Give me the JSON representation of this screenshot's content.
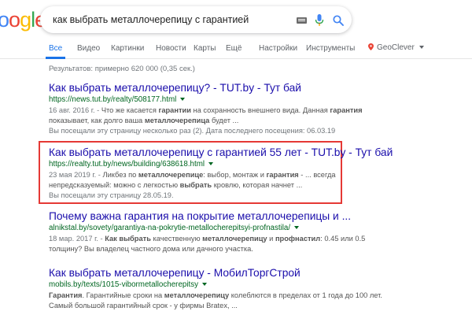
{
  "logo": {
    "text": "ogle"
  },
  "search": {
    "query": "как выбрать металлочерепицу с гарантией"
  },
  "tabs": [
    {
      "label": "Все",
      "active": true
    },
    {
      "label": "Видео"
    },
    {
      "label": "Картинки"
    },
    {
      "label": "Новости"
    },
    {
      "label": "Карты"
    },
    {
      "label": "Ещё"
    },
    {
      "label": "Настройки"
    },
    {
      "label": "Инструменты"
    }
  ],
  "location": {
    "label": "GeoClever"
  },
  "stats": {
    "text": "Результатов: примерно 620 000 (0,35 сек.)"
  },
  "results": [
    {
      "title": "Как выбрать металлочерепицу? - TUT.by - Тут бай",
      "url": "https://news.tut.by/realty/508177.html",
      "date": "16 авг. 2016 г. -",
      "snippet": [
        [
          {
            "t": " Что же касается "
          },
          {
            "t": "гарантии",
            "b": true
          },
          {
            "t": " на сохранность внешнего вида. Данная "
          },
          {
            "t": "гарантия",
            "b": true
          }
        ],
        [
          {
            "t": "показывает, как долго ваша "
          },
          {
            "t": "металлочерепица",
            "b": true
          },
          {
            "t": " будет ..."
          }
        ]
      ],
      "visited": "Вы посещали эту страницу несколько раз (2). Дата последнего посещения: 06.03.19"
    },
    {
      "title": "Как выбрать металлочерепицу с гарантией 55 лет - TUT.by - Тут бай",
      "url": "https://realty.tut.by/news/building/638618.html",
      "date": "23 мая 2019 г. -",
      "snippet": [
        [
          {
            "t": " Ликбез по "
          },
          {
            "t": "металлочерепице",
            "b": true
          },
          {
            "t": ": выбор, монтаж и "
          },
          {
            "t": "гарантия",
            "b": true
          },
          {
            "t": " - ... всегда"
          }
        ],
        [
          {
            "t": "непредсказуемый: можно с легкостью "
          },
          {
            "t": "выбрать",
            "b": true
          },
          {
            "t": " кровлю, которая начнет ..."
          }
        ]
      ],
      "visited": "Вы посещали эту страницу 28.05.19."
    },
    {
      "title": "Почему важна гарантия на покрытие металлочерепицы и ...",
      "url": "alnikstal.by/sovety/garantiya-na-pokrytie-metallocherepitsyi-profnastila/",
      "date": "18 мар. 2017 г. -",
      "snippet": [
        [
          {
            "t": " "
          },
          {
            "t": "Как выбрать",
            "b": true
          },
          {
            "t": " качественную "
          },
          {
            "t": "металлочерепицу",
            "b": true
          },
          {
            "t": " и "
          },
          {
            "t": "профнастил",
            "b": true
          },
          {
            "t": ": 0.45 или 0.5"
          }
        ],
        [
          {
            "t": "толщину? Вы владелец частного дома или дачного участка."
          }
        ]
      ],
      "visited": ""
    },
    {
      "title": "Как выбрать металлочерепицу - МобилТоргСтрой",
      "url": "mobils.by/texts/1015-vibormetallocherepitsy",
      "date": "",
      "snippet": [
        [
          {
            "t": "Гарантия",
            "b": true
          },
          {
            "t": ". Гарантийные сроки на "
          },
          {
            "t": "металлочерепицу",
            "b": true
          },
          {
            "t": " колеблются в пределах от 1 года до 100 лет."
          }
        ],
        [
          {
            "t": "Самый большой гарантийный срок - у фирмы Bratex, ..."
          }
        ]
      ],
      "visited": ""
    }
  ],
  "colors": {
    "link": "#1a0dab",
    "url": "#006621",
    "tab_active": "#1a73e8",
    "highlight": "#e53935"
  }
}
